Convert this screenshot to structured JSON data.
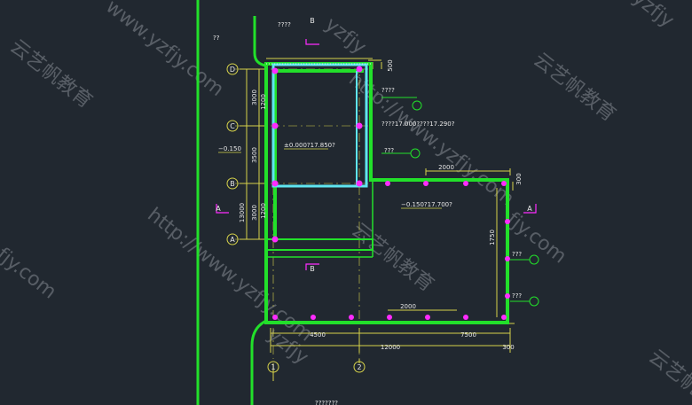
{
  "colors": {
    "background": "#212830",
    "wall": "#22e02a",
    "water_line": "#5fe6f0",
    "node": "#ff2bff",
    "dim": "#d6d24a",
    "text": "#e8e8e8",
    "watermark": "#6b7178"
  },
  "labels": {
    "top_note": "????",
    "left_note": "??",
    "elev_left": "−0.150",
    "elev_main": "±0.000?17.850?",
    "elev_right": "−0.150?17.700?",
    "note_a": "????",
    "note_range": "????17.000????17.290?",
    "note_b": "???",
    "note_c": "???",
    "note_d": "???",
    "section_b": "B",
    "section_a": "A",
    "bottom_caption": "???????"
  },
  "axes": {
    "rows": [
      "D",
      "C",
      "B",
      "A"
    ],
    "cols": [
      "1",
      "2"
    ]
  },
  "dims": {
    "left_total": "13000",
    "left_d_c": "3000",
    "left_d_c_inner": "1200",
    "left_c_b": "3500",
    "left_b_a": "3000",
    "left_b_a_inner": "1200",
    "top_right": "500",
    "right_mid": "300",
    "right_upper": "2000",
    "right_height": "1750",
    "lower_span": "2000",
    "bottom_left": "4500",
    "bottom_right": "7500",
    "bottom_total": "12000",
    "bottom_corner": "300"
  },
  "watermarks": {
    "url": "http://www.yzfjy.com",
    "url_short": "www.yzfjy.com",
    "brand": "云艺帆教育",
    "fragment_a": "yzfjy",
    "fragment_b": "fjy.com",
    "fragment_c": "云艺帆"
  }
}
